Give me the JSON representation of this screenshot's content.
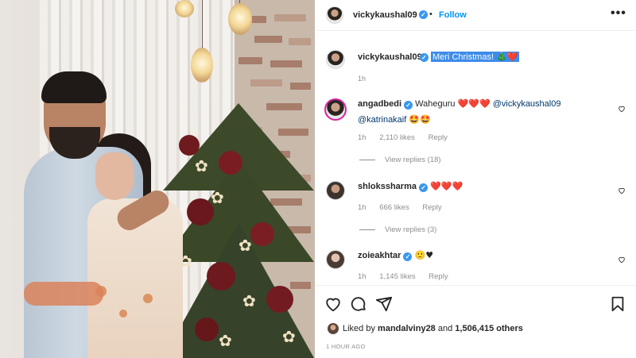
{
  "post": {
    "author": "vickykaushal09",
    "follow_label": "Follow",
    "separator": "•",
    "more_label": "•••",
    "caption": "Meri Christmas!",
    "caption_emojis": "🎄❤️",
    "caption_time": "1h",
    "likes_prefix": "Liked by",
    "likes_user": "mandalviny28",
    "likes_and": "and",
    "likes_count": "1,506,415 others",
    "timestamp": "1 HOUR AGO"
  },
  "comments": [
    {
      "user": "angadbedi",
      "text": "Waheguru",
      "emojis": "❤️❤️❤️",
      "mention1": "@vickykaushal09",
      "mention2": "@katrinakaif",
      "emojis2": "🤩🤩",
      "time": "1h",
      "likes": "2,110 likes",
      "reply": "Reply",
      "view_replies": "View replies (18)"
    },
    {
      "user": "shlokssharma",
      "emojis": "❤️❤️❤️",
      "time": "1h",
      "likes": "666 likes",
      "reply": "Reply",
      "view_replies": "View replies (3)"
    },
    {
      "user": "zoieakhtar",
      "emojis": "🙂♥",
      "time": "1h",
      "likes": "1,145 likes",
      "reply": "Reply"
    }
  ],
  "icons": [
    "heart-icon",
    "comment-icon",
    "share-icon",
    "bookmark-icon",
    "more-icon",
    "verified-icon"
  ],
  "colors": {
    "accent": "#0095f6",
    "verified": "#3897f0",
    "selection": "#3d8ce9",
    "muted": "#8e8e8e"
  }
}
